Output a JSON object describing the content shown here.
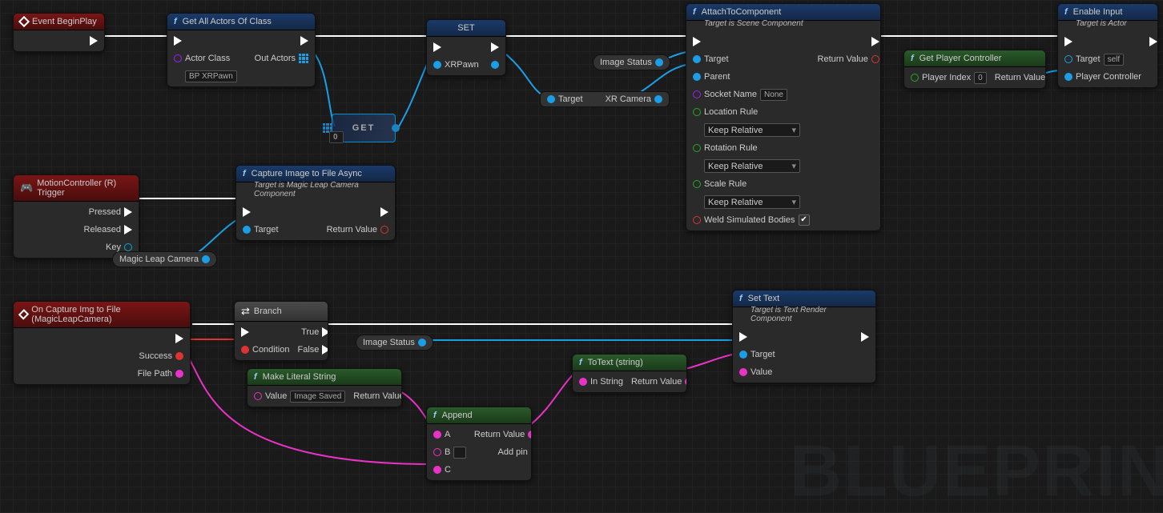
{
  "watermark": "BLUEPRIN",
  "nodes": {
    "beginplay": {
      "title": "Event BeginPlay"
    },
    "getactors": {
      "title": "Get All Actors Of Class",
      "actor_class_label": "Actor Class",
      "actor_class_value": "BP XRPawn",
      "out_actors": "Out Actors"
    },
    "set": {
      "title": "SET",
      "var": "XRPawn"
    },
    "getnode": {
      "title": "GET",
      "index": "0"
    },
    "imagestatus_pill": {
      "label": "Image Status"
    },
    "target_xrcamera": {
      "target": "Target",
      "val": "XR Camera"
    },
    "attach": {
      "title": "AttachToComponent",
      "subtitle": "Target is Scene Component",
      "target": "Target",
      "parent": "Parent",
      "socket": "Socket Name",
      "socket_val": "None",
      "loc": "Location Rule",
      "loc_val": "Keep Relative",
      "rot": "Rotation Rule",
      "rot_val": "Keep Relative",
      "scale": "Scale Rule",
      "scale_val": "Keep Relative",
      "weld": "Weld Simulated Bodies",
      "retval": "Return Value"
    },
    "enableinput": {
      "title": "Enable Input",
      "subtitle": "Target is Actor",
      "target": "Target",
      "target_val": "self",
      "pc": "Player Controller"
    },
    "getpc": {
      "title": "Get Player Controller",
      "idx": "Player Index",
      "idx_val": "0",
      "retval": "Return Value"
    },
    "motion": {
      "title": "MotionController (R) Trigger",
      "pressed": "Pressed",
      "released": "Released",
      "key": "Key"
    },
    "capture": {
      "title": "Capture Image to File Async",
      "subtitle": "Target is Magic Leap Camera Component",
      "target": "Target",
      "retval": "Return Value"
    },
    "mlcamera_pill": {
      "label": "Magic Leap Camera"
    },
    "oncapture": {
      "title": "On Capture Img to File (MagicLeapCamera)",
      "success": "Success",
      "filepath": "File Path"
    },
    "branch": {
      "title": "Branch",
      "cond": "Condition",
      "true": "True",
      "false": "False"
    },
    "imagestatus_pill2": {
      "label": "Image Status"
    },
    "settext": {
      "title": "Set Text",
      "subtitle": "Target is Text Render Component",
      "target": "Target",
      "value": "Value"
    },
    "makeliteral": {
      "title": "Make Literal String",
      "value": "Value",
      "value_val": "Image Saved",
      "retval": "Return Value"
    },
    "append": {
      "title": "Append",
      "a": "A",
      "b": "B",
      "c": "C",
      "retval": "Return Value",
      "addpin": "Add pin"
    },
    "totext": {
      "title": "ToText (string)",
      "in": "In String",
      "retval": "Return Value"
    }
  }
}
